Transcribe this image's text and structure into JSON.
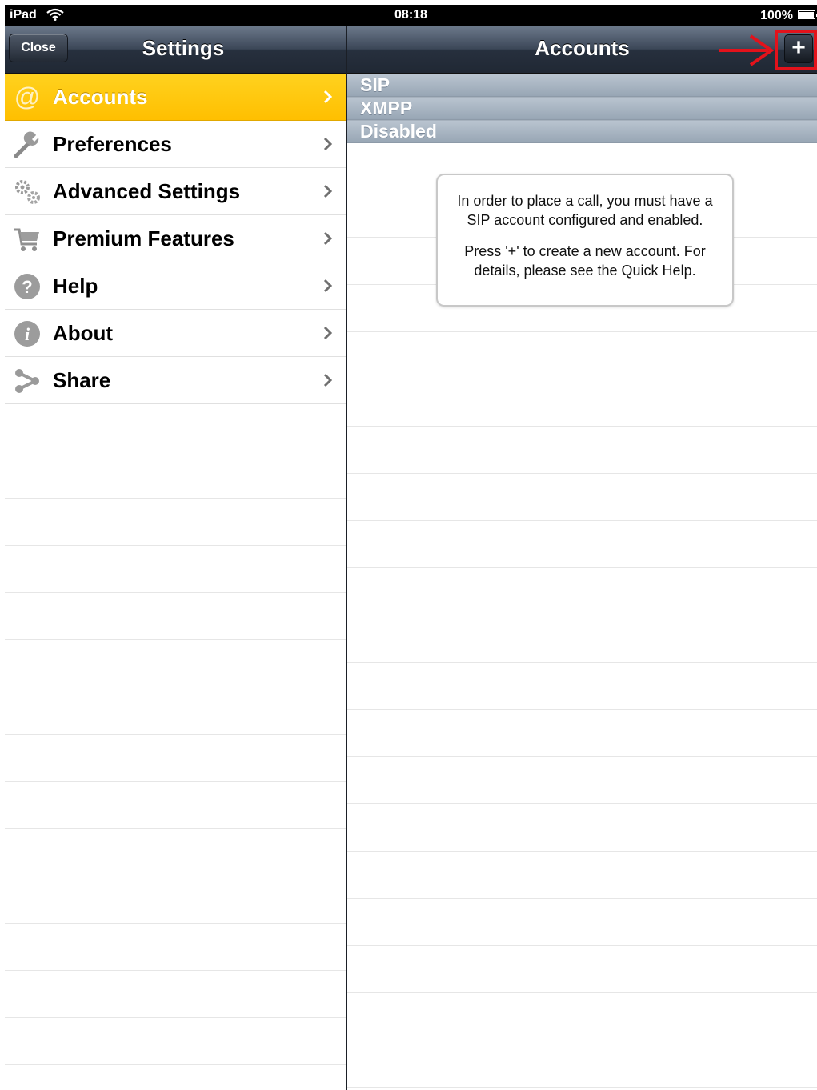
{
  "status_bar": {
    "device": "iPad",
    "time": "08:18",
    "battery": "100%"
  },
  "left_nav": {
    "close_label": "Close",
    "title": "Settings"
  },
  "menu": {
    "items": [
      {
        "label": "Accounts",
        "icon": "at-sign-icon",
        "selected": true
      },
      {
        "label": "Preferences",
        "icon": "wrench-icon",
        "selected": false
      },
      {
        "label": "Advanced Settings",
        "icon": "gears-icon",
        "selected": false
      },
      {
        "label": "Premium Features",
        "icon": "shopping-cart-icon",
        "selected": false
      },
      {
        "label": "Help",
        "icon": "question-icon",
        "selected": false
      },
      {
        "label": "About",
        "icon": "info-icon",
        "selected": false
      },
      {
        "label": "Share",
        "icon": "share-icon",
        "selected": false
      }
    ]
  },
  "right_nav": {
    "title": "Accounts",
    "add_label": "+"
  },
  "sections": [
    "SIP",
    "XMPP",
    "Disabled"
  ],
  "info_box": {
    "line1": "In order to place a call, you must have a SIP account configured and enabled.",
    "line2": "Press '+' to create a new account. For details, please see the Quick Help."
  },
  "colors": {
    "selected_row": "#ffc400",
    "nav_bar": "#2b3442",
    "annotation": "#e3121b"
  }
}
